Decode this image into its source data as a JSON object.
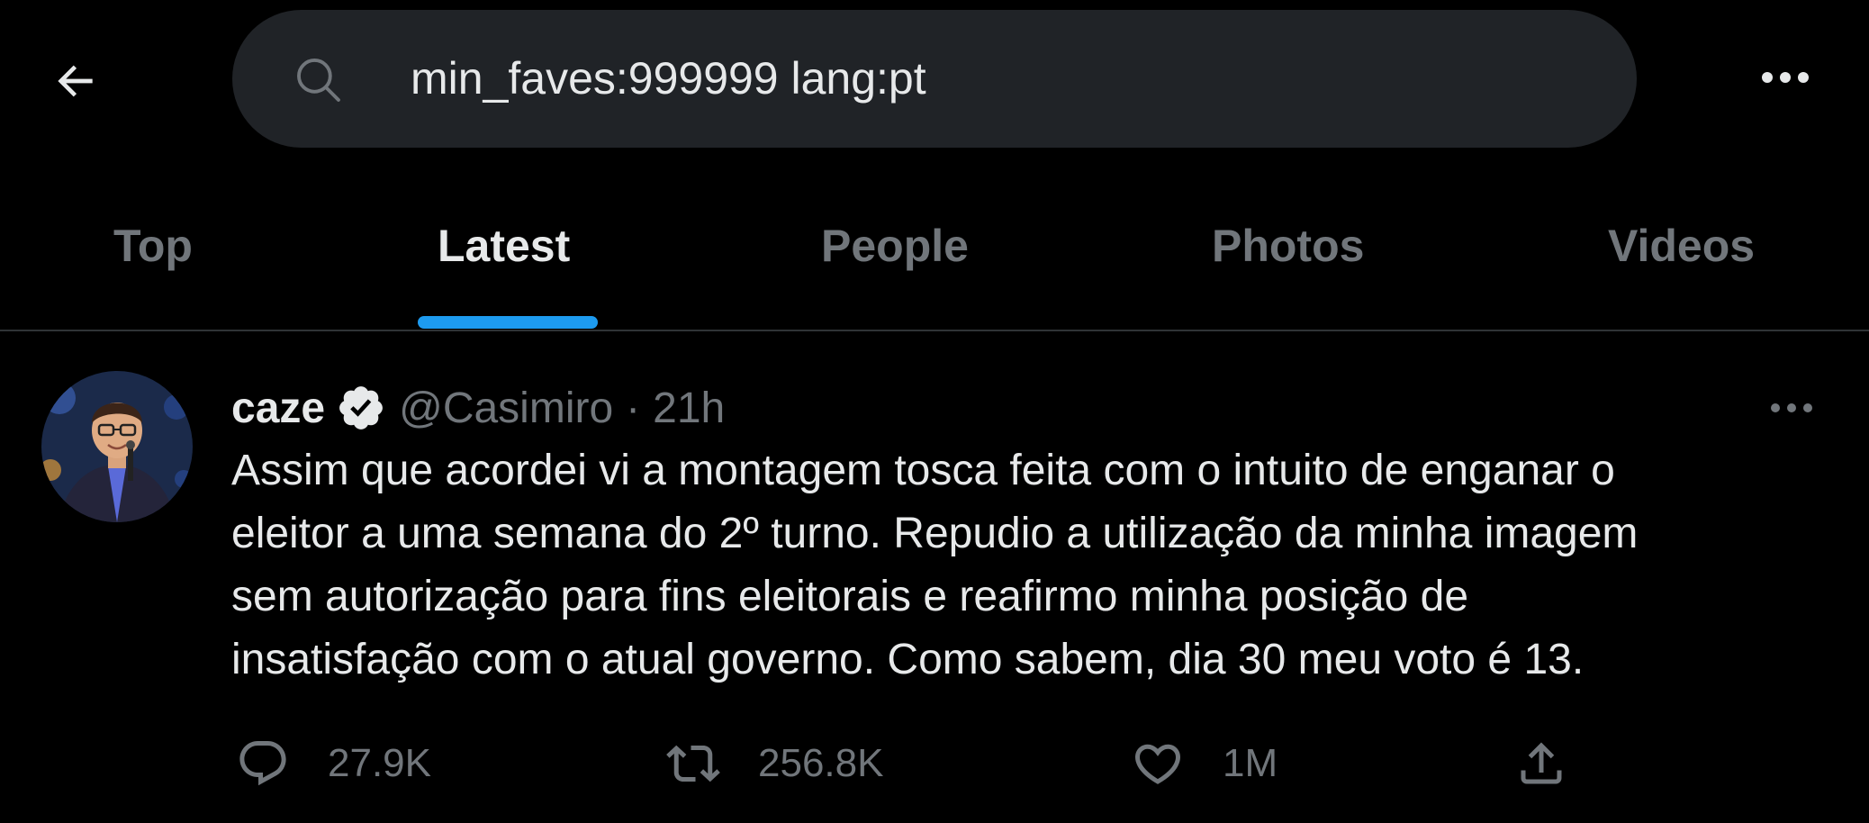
{
  "search": {
    "value": "min_faves:999999 lang:pt",
    "back_icon": "arrow-left-icon",
    "search_icon": "search-icon",
    "more_icon": "more-horizontal-icon"
  },
  "tabs": [
    {
      "label": "Top",
      "active": false
    },
    {
      "label": "Latest",
      "active": true
    },
    {
      "label": "People",
      "active": false
    },
    {
      "label": "Photos",
      "active": false
    },
    {
      "label": "Videos",
      "active": false
    }
  ],
  "tweet": {
    "display_name": "caze",
    "verified": true,
    "handle": "@Casimiro",
    "separator": "·",
    "time": "21h",
    "text_lines": [
      "Assim que acordei vi a montagem tosca feita com o intuito de enganar o",
      "eleitor a uma semana do 2º turno. Repudio a utilização da minha imagem",
      "sem autorização para fins eleitorais e reafirmo minha posição de",
      "insatisfação com o atual governo. Como sabem, dia 30 meu voto é 13."
    ],
    "actions": {
      "reply_count": "27.9K",
      "retweet_count": "256.8K",
      "like_count": "1M",
      "share_icon": "share-icon"
    }
  },
  "colors": {
    "background": "#000000",
    "search_bg": "#202327",
    "text_primary": "#e7e9ea",
    "text_secondary": "#71767b",
    "accent": "#1d9bf0",
    "divider": "#2f3336"
  }
}
